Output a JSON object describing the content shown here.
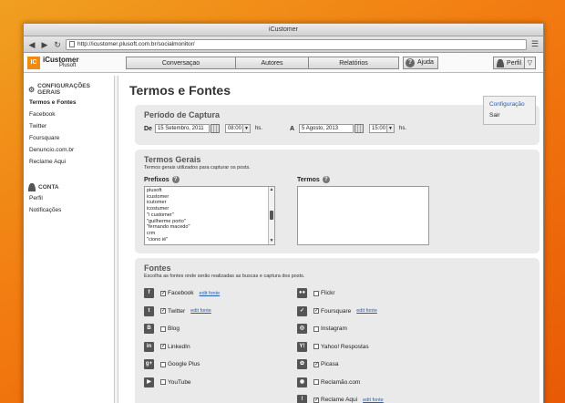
{
  "window": {
    "title": "iCustomer",
    "url": "http://icustomer.plusoft.com.br/socialmonitor/"
  },
  "app": {
    "logo_mark": "IC",
    "name": "iCustomer",
    "company": "Plusoft"
  },
  "nav": {
    "tabs": [
      "Conversaçao",
      "Autores",
      "Relatórios"
    ],
    "help": "Ajuda"
  },
  "profile": {
    "label": "Perfil",
    "menu": [
      "Configuração",
      "Sair"
    ]
  },
  "sidebar": {
    "section1": "CONFIGURAÇÕES GERAIS",
    "items": [
      "Termos e Fontes",
      "Facebook",
      "Twitter",
      "Foursquare",
      "Denuncio.com.br",
      "Reclame Aqui"
    ],
    "section2": "CONTA",
    "items2": [
      "Perfil",
      "Notificações"
    ]
  },
  "page": {
    "title": "Termos e Fontes"
  },
  "capture": {
    "title": "Período de Captura",
    "from_label": "De",
    "from_date": "15 Setembro, 2011",
    "from_time": "08:00",
    "to_label": "A",
    "to_date": "5 Agosto, 2013",
    "to_time": "15:00",
    "hs": "hs."
  },
  "terms": {
    "title": "Termos Gerais",
    "desc": "Termos gerais utilizados para capturar os posts.",
    "prefixes_label": "Prefixos",
    "prefixes": [
      "plusoft",
      "icustomer",
      "icutomer",
      "icostumer",
      "\"i customer\"",
      "\"guilherme porto\"",
      "\"fernando macedo\"",
      "crm",
      "\"ciono ié\""
    ],
    "terms_label": "Termos"
  },
  "sources": {
    "title": "Fontes",
    "desc": "Escolha as fontes onde serão realizadas as buscas e captura dos posts.",
    "edit_label": "edit fonte",
    "left": [
      {
        "name": "Facebook",
        "checked": true,
        "edit": true,
        "icon": "facebook-icon",
        "glyph": "f"
      },
      {
        "name": "Twitter",
        "checked": true,
        "edit": true,
        "icon": "twitter-icon",
        "glyph": "t"
      },
      {
        "name": "Blog",
        "checked": false,
        "edit": false,
        "icon": "blog-icon",
        "glyph": "B"
      },
      {
        "name": "LinkedIn",
        "checked": true,
        "edit": false,
        "icon": "linkedin-icon",
        "glyph": "in"
      },
      {
        "name": "Google Plus",
        "checked": false,
        "edit": false,
        "icon": "google-plus-icon",
        "glyph": "g+"
      },
      {
        "name": "YouTube",
        "checked": false,
        "edit": false,
        "icon": "youtube-icon",
        "glyph": "▶"
      }
    ],
    "right": [
      {
        "name": "Flickr",
        "checked": false,
        "edit": false,
        "icon": "flickr-icon",
        "glyph": "●●"
      },
      {
        "name": "Foursquare",
        "checked": true,
        "edit": true,
        "icon": "foursquare-icon",
        "glyph": "✓"
      },
      {
        "name": "Instagram",
        "checked": false,
        "edit": false,
        "icon": "instagram-icon",
        "glyph": "◎"
      },
      {
        "name": "Yahoo! Respostas",
        "checked": false,
        "edit": false,
        "icon": "yahoo-icon",
        "glyph": "Y!"
      },
      {
        "name": "Picasa",
        "checked": true,
        "edit": false,
        "icon": "picasa-icon",
        "glyph": "✿"
      },
      {
        "name": "Reclamão.com",
        "checked": false,
        "edit": false,
        "icon": "reclamao-icon",
        "glyph": "◉"
      },
      {
        "name": "Reclame Aqui",
        "checked": true,
        "edit": true,
        "icon": "reclame-aqui-icon",
        "glyph": "!"
      }
    ]
  }
}
